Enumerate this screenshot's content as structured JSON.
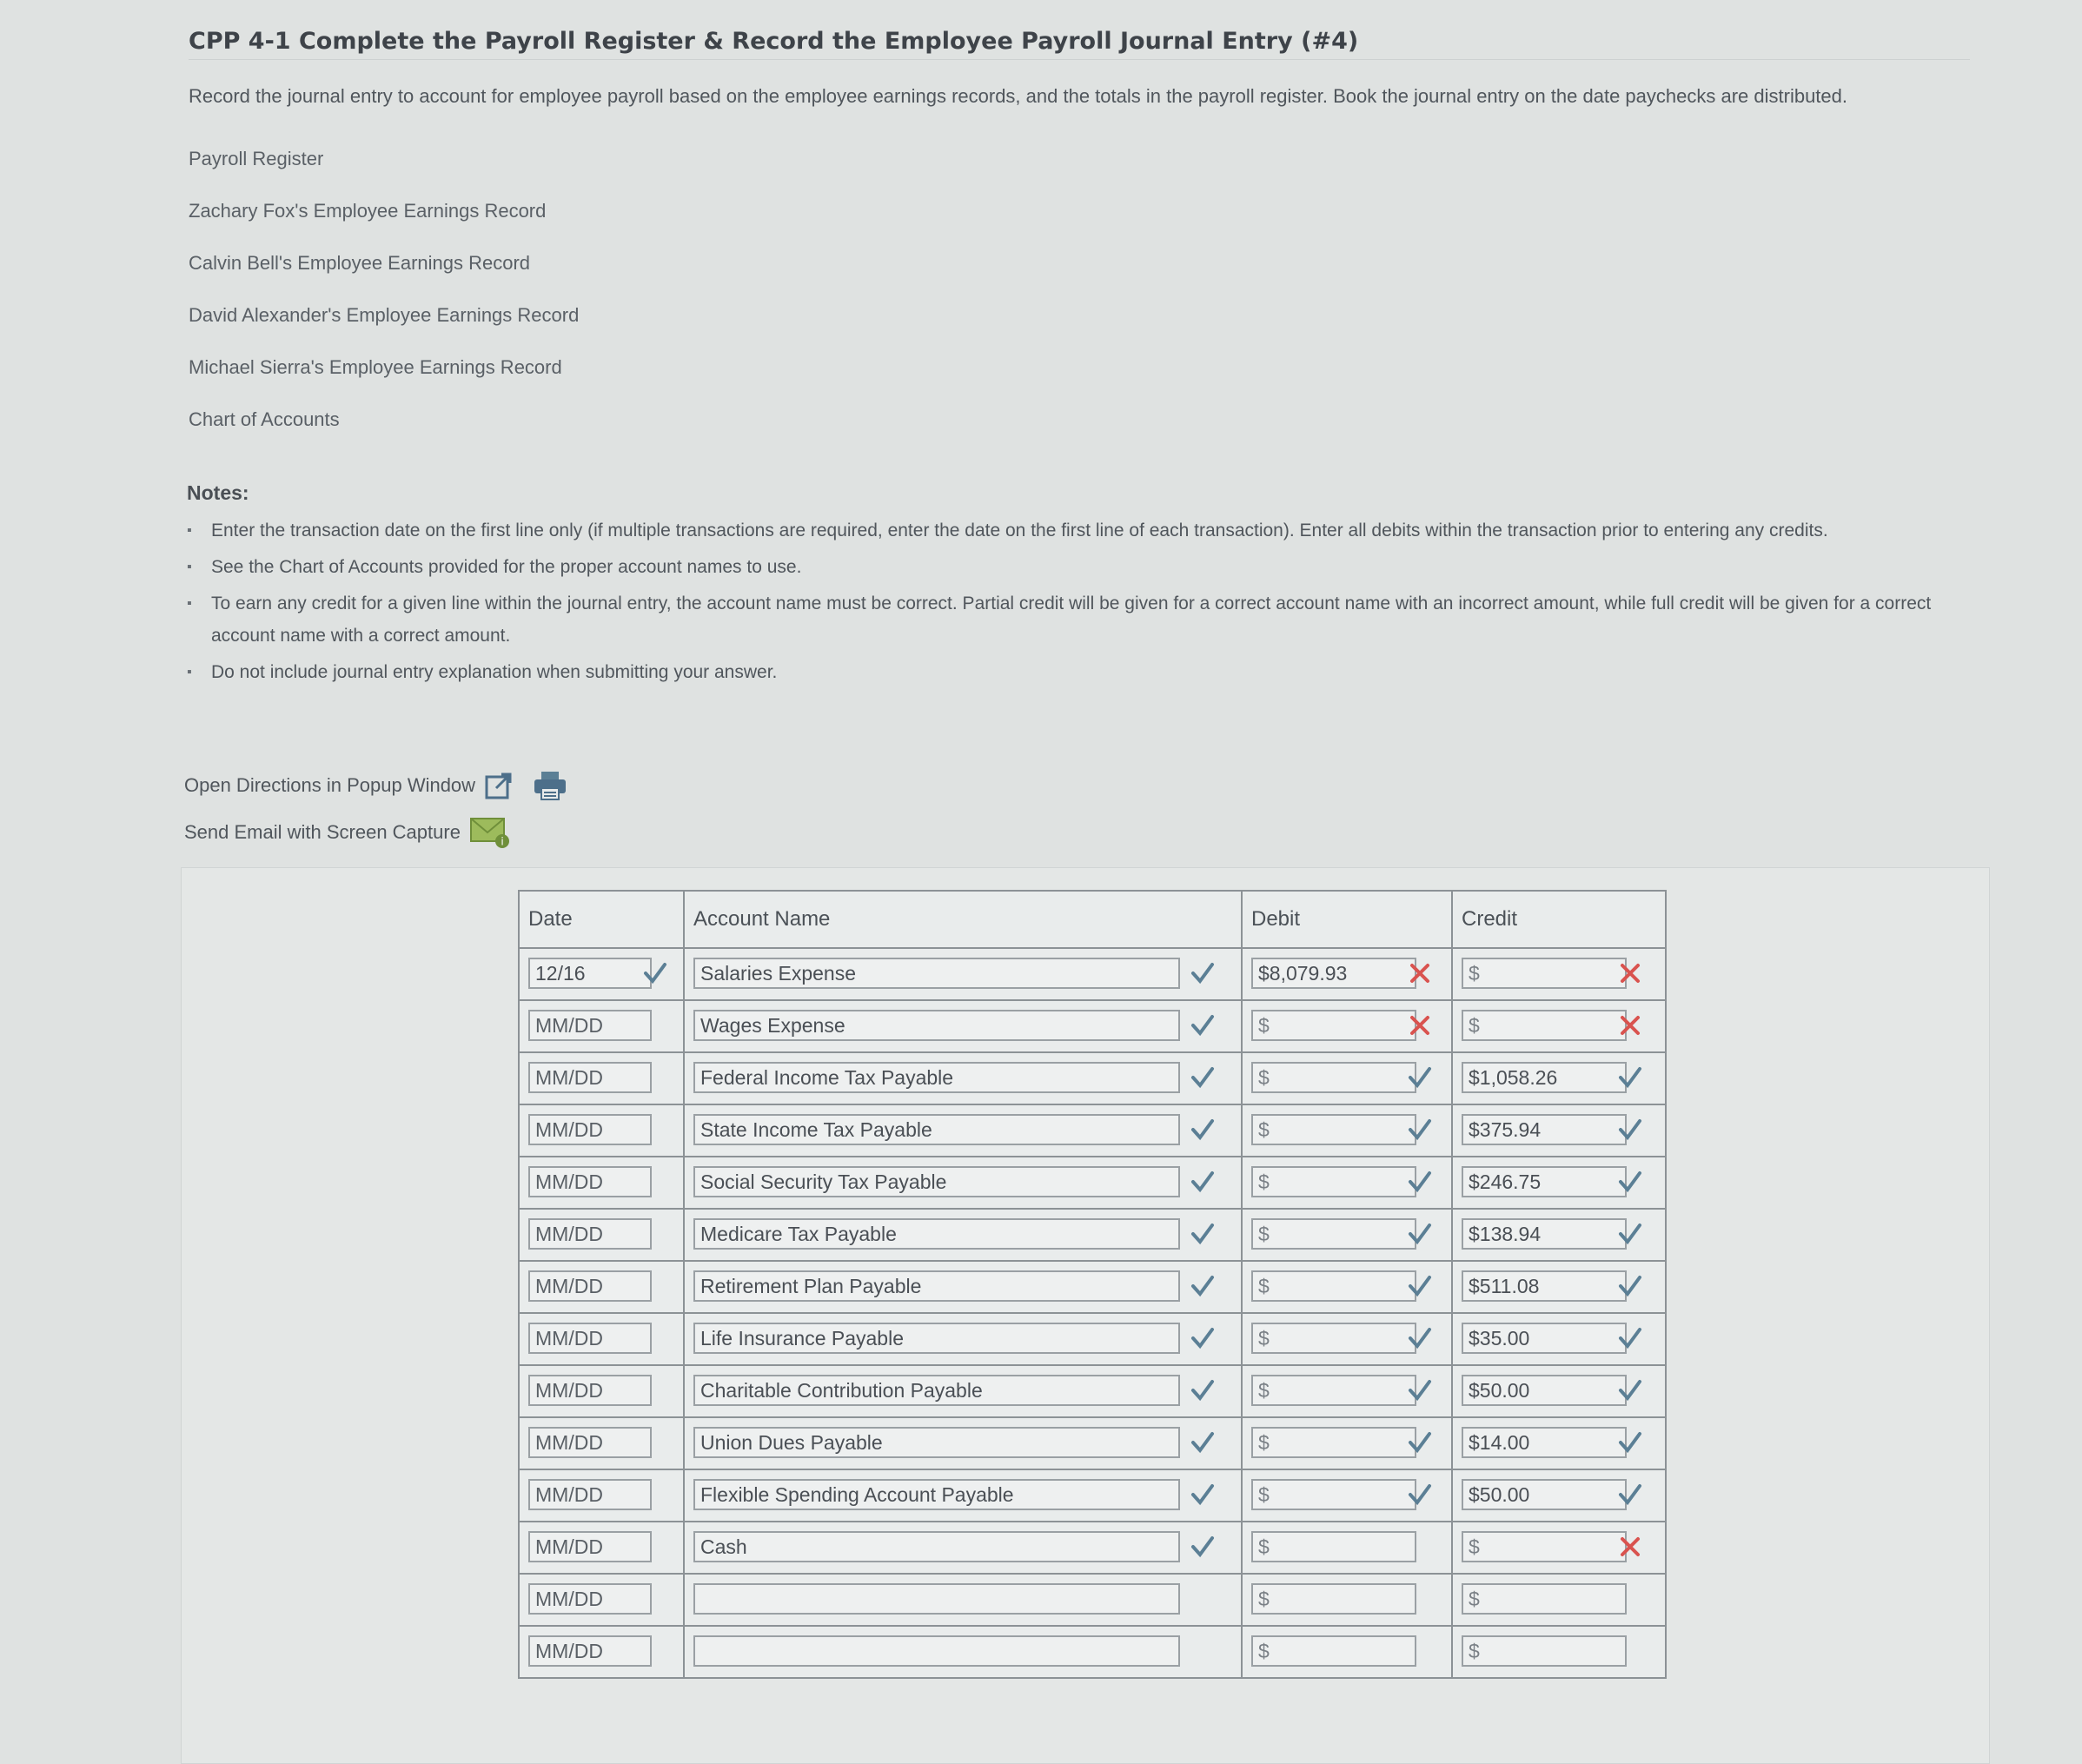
{
  "header": {
    "title": "CPP 4-1 Complete the Payroll Register & Record the Employee Payroll Journal Entry (#4)",
    "intro": "Record the journal entry to account for employee payroll based on the employee earnings records, and the totals in the payroll register. Book the journal entry on the date paychecks are distributed."
  },
  "links": [
    "Payroll Register",
    "Zachary Fox's Employee Earnings Record",
    "Calvin Bell's Employee Earnings Record",
    "David Alexander's Employee Earnings Record",
    "Michael Sierra's Employee Earnings Record",
    "Chart of Accounts"
  ],
  "notes": {
    "label": "Notes:",
    "items": [
      "Enter the transaction date on the first line only (if multiple transactions are required, enter the date on the first line of each transaction). Enter all debits within the transaction prior to entering any credits.",
      "See the Chart of Accounts provided for the proper account names to use.",
      "To earn any credit for a given line within the journal entry, the account name must be correct. Partial credit will be given for a correct account name with an incorrect amount, while full credit will be given for a correct account name with a correct amount.",
      "Do not include journal entry explanation when submitting your answer."
    ]
  },
  "tools": {
    "popup": "Open Directions in Popup Window",
    "email": "Send Email with Screen Capture"
  },
  "journal": {
    "headers": {
      "date": "Date",
      "account": "Account Name",
      "debit": "Debit",
      "credit": "Credit"
    },
    "date_placeholder": "MM/DD",
    "money_placeholder": "$",
    "colors": {
      "correct": "#5b7f95",
      "incorrect": "#d9534f"
    },
    "rows": [
      {
        "date": "12/16",
        "date_mark": "check",
        "account": "Salaries Expense",
        "account_mark": "check",
        "debit": "$8,079.93",
        "debit_mark": "x",
        "credit": "$",
        "credit_mark": "x"
      },
      {
        "date": "MM/DD",
        "date_mark": "",
        "account": "Wages Expense",
        "account_mark": "check",
        "debit": "$",
        "debit_mark": "x",
        "credit": "$",
        "credit_mark": "x"
      },
      {
        "date": "MM/DD",
        "date_mark": "",
        "account": "Federal Income Tax Payable",
        "account_mark": "check",
        "debit": "$",
        "debit_mark": "check",
        "credit": "$1,058.26",
        "credit_mark": "check"
      },
      {
        "date": "MM/DD",
        "date_mark": "",
        "account": "State Income Tax Payable",
        "account_mark": "check",
        "debit": "$",
        "debit_mark": "check",
        "credit": "$375.94",
        "credit_mark": "check"
      },
      {
        "date": "MM/DD",
        "date_mark": "",
        "account": "Social Security Tax Payable",
        "account_mark": "check",
        "debit": "$",
        "debit_mark": "check",
        "credit": "$246.75",
        "credit_mark": "check"
      },
      {
        "date": "MM/DD",
        "date_mark": "",
        "account": "Medicare Tax Payable",
        "account_mark": "check",
        "debit": "$",
        "debit_mark": "check",
        "credit": "$138.94",
        "credit_mark": "check"
      },
      {
        "date": "MM/DD",
        "date_mark": "",
        "account": "Retirement Plan Payable",
        "account_mark": "check",
        "debit": "$",
        "debit_mark": "check",
        "credit": "$511.08",
        "credit_mark": "check"
      },
      {
        "date": "MM/DD",
        "date_mark": "",
        "account": "Life Insurance Payable",
        "account_mark": "check",
        "debit": "$",
        "debit_mark": "check",
        "credit": "$35.00",
        "credit_mark": "check"
      },
      {
        "date": "MM/DD",
        "date_mark": "",
        "account": "Charitable Contribution Payable",
        "account_mark": "check",
        "debit": "$",
        "debit_mark": "check",
        "credit": "$50.00",
        "credit_mark": "check"
      },
      {
        "date": "MM/DD",
        "date_mark": "",
        "account": "Union Dues Payable",
        "account_mark": "check",
        "debit": "$",
        "debit_mark": "check",
        "credit": "$14.00",
        "credit_mark": "check"
      },
      {
        "date": "MM/DD",
        "date_mark": "",
        "account": "Flexible Spending Account Payable",
        "account_mark": "check",
        "debit": "$",
        "debit_mark": "check",
        "credit": "$50.00",
        "credit_mark": "check"
      },
      {
        "date": "MM/DD",
        "date_mark": "",
        "account": "Cash",
        "account_mark": "check",
        "debit": "$",
        "debit_mark": "",
        "credit": "$",
        "credit_mark": "x"
      },
      {
        "date": "MM/DD",
        "date_mark": "",
        "account": "",
        "account_mark": "",
        "debit": "$",
        "debit_mark": "",
        "credit": "$",
        "credit_mark": ""
      },
      {
        "date": "MM/DD",
        "date_mark": "",
        "account": "",
        "account_mark": "",
        "debit": "$",
        "debit_mark": "",
        "credit": "$",
        "credit_mark": ""
      }
    ]
  }
}
